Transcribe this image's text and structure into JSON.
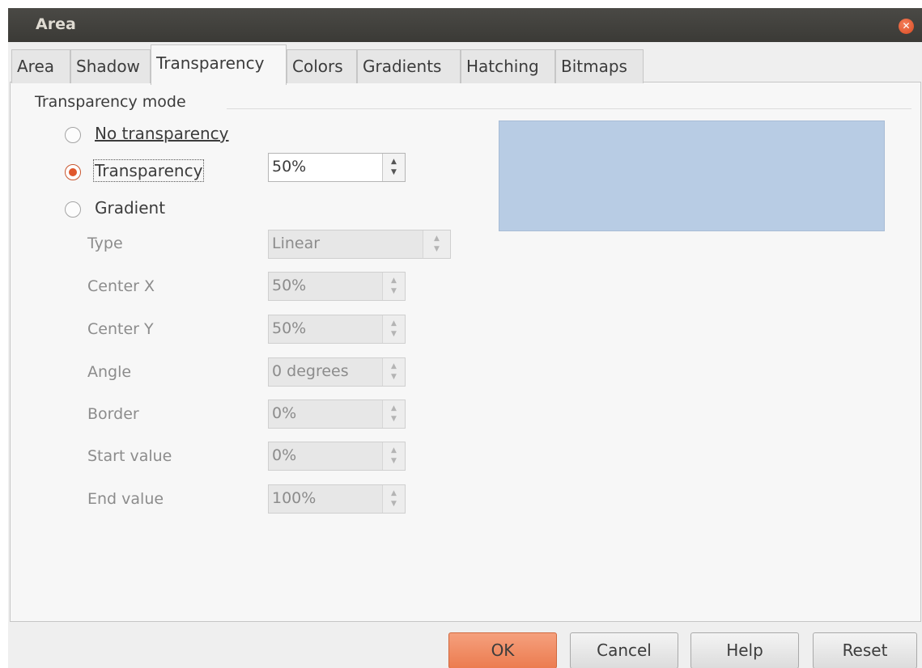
{
  "window": {
    "title": "Area"
  },
  "tabs": [
    {
      "label": "Area",
      "active": false
    },
    {
      "label": "Shadow",
      "active": false
    },
    {
      "label": "Transparency",
      "active": true
    },
    {
      "label": "Colors",
      "active": false
    },
    {
      "label": "Gradients",
      "active": false
    },
    {
      "label": "Hatching",
      "active": false
    },
    {
      "label": "Bitmaps",
      "active": false
    }
  ],
  "transparency_mode": {
    "group_label": "Transparency mode",
    "options": [
      {
        "label": "No transparency",
        "checked": false
      },
      {
        "label": "Transparency",
        "checked": true
      },
      {
        "label": "Gradient",
        "checked": false
      }
    ],
    "transparency_value": "50%"
  },
  "gradient": {
    "type": {
      "label": "Type",
      "value": "Linear"
    },
    "center_x": {
      "label": "Center X",
      "value": "50%"
    },
    "center_y": {
      "label": "Center Y",
      "value": "50%"
    },
    "angle": {
      "label": "Angle",
      "value": "0 degrees"
    },
    "border": {
      "label": "Border",
      "value": "0%"
    },
    "start_value": {
      "label": "Start value",
      "value": "0%"
    },
    "end_value": {
      "label": "End value",
      "value": "100%"
    }
  },
  "preview": {
    "fill_color": "#b8cce4"
  },
  "buttons": {
    "ok": "OK",
    "cancel": "Cancel",
    "help": "Help",
    "reset": "Reset"
  },
  "colors": {
    "accent": "#e0572c",
    "titlebar": "#3b3a36",
    "default_button": "#ec7c50"
  }
}
